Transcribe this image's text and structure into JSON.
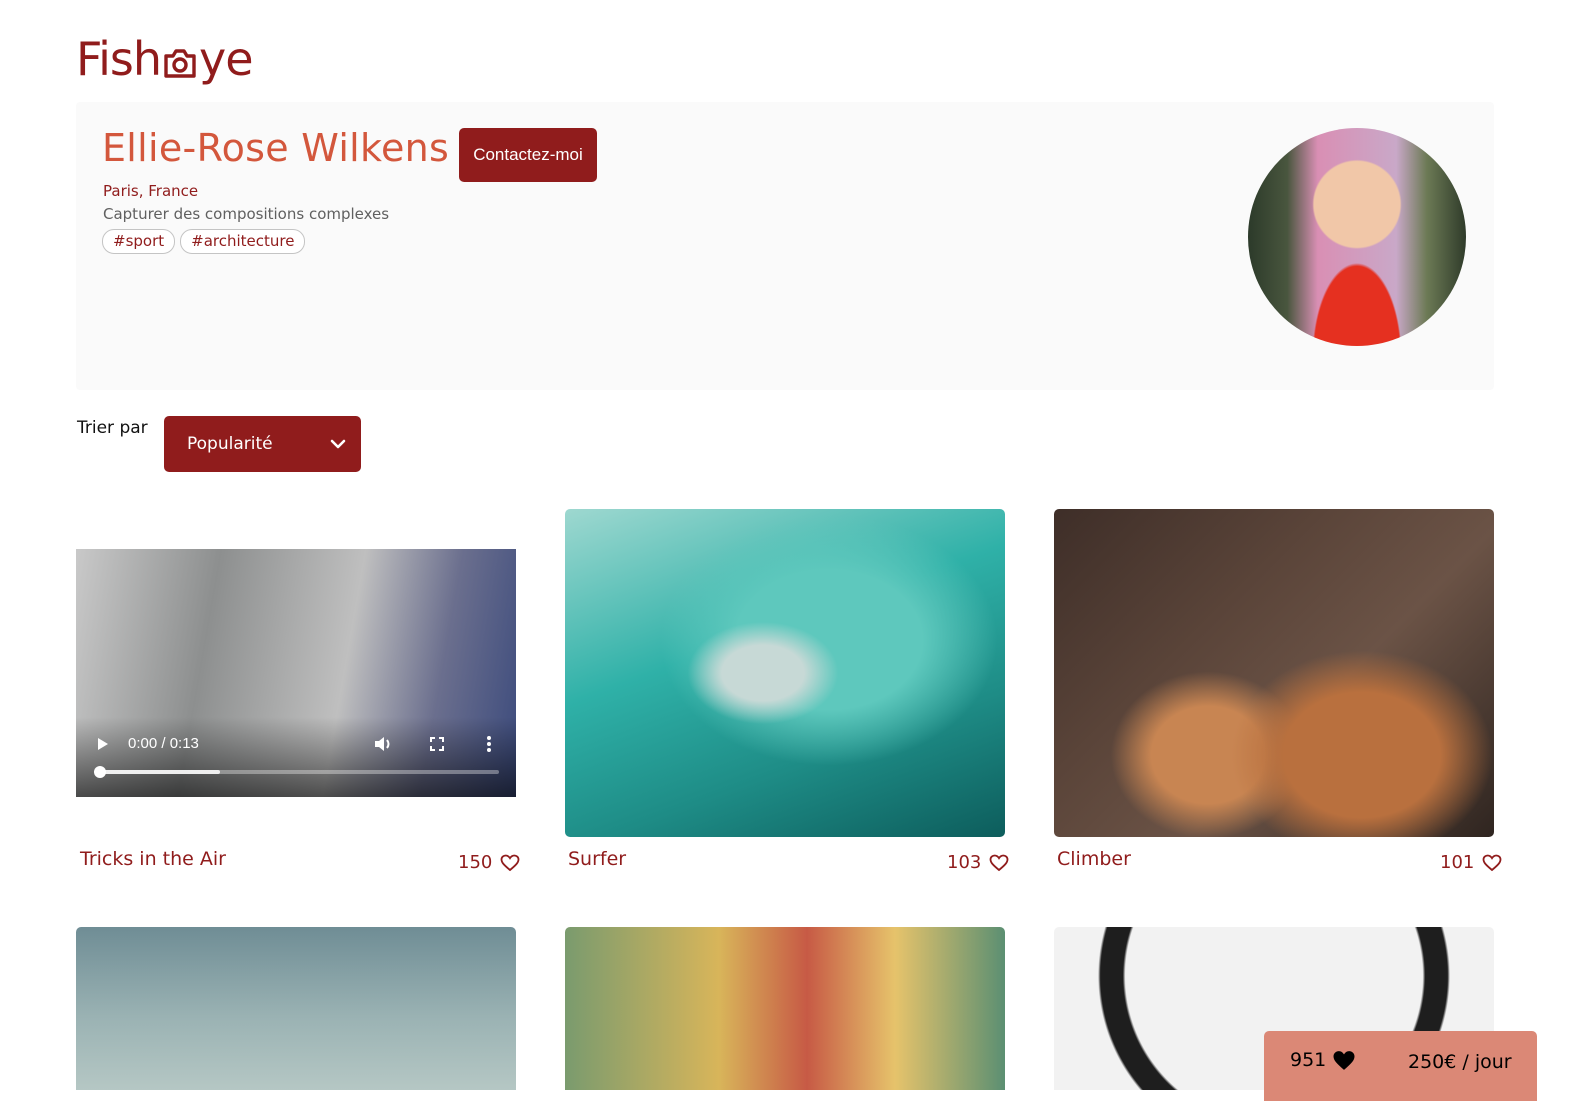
{
  "logo": {
    "text_left": "Fish",
    "text_right": "ye"
  },
  "photographer": {
    "name": "Ellie-Rose Wilkens",
    "location": "Paris, France",
    "tagline": "Capturer des compositions complexes",
    "tags": [
      "#sport",
      "#architecture"
    ],
    "contact_label": "Contactez-moi"
  },
  "sort": {
    "label": "Trier par",
    "selected": "Popularité"
  },
  "media": [
    {
      "title": "Tricks in the Air",
      "likes": "150",
      "type": "video",
      "time": "0:00 / 0:13",
      "progress": 0.3
    },
    {
      "title": "Surfer",
      "likes": "103",
      "type": "image"
    },
    {
      "title": "Climber",
      "likes": "101",
      "type": "image"
    }
  ],
  "summary": {
    "total_likes": "951",
    "price": "250€ / jour"
  },
  "colors": {
    "primary": "#901c1c",
    "secondary": "#d3573c",
    "summary_bg": "#db8876"
  }
}
